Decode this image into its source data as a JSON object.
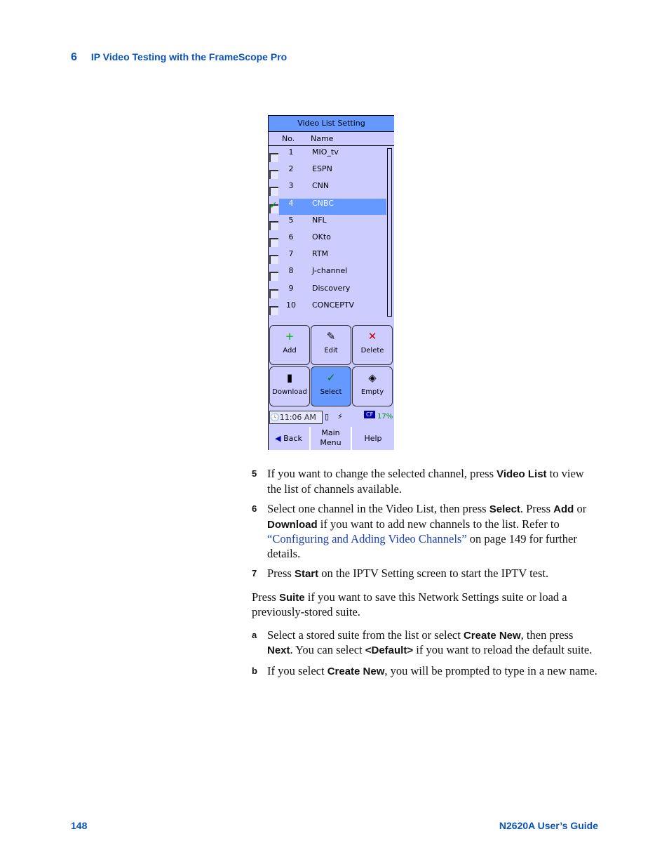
{
  "header": {
    "chapter": "6",
    "title": "IP Video Testing with the FrameScope Pro"
  },
  "device": {
    "title": "Video List Setting",
    "columns": [
      "No.",
      "Name"
    ],
    "rows": [
      {
        "no": "1",
        "name": "MIO_tv",
        "checked": false
      },
      {
        "no": "2",
        "name": "ESPN",
        "checked": false
      },
      {
        "no": "3",
        "name": "CNN",
        "checked": false
      },
      {
        "no": "4",
        "name": "CNBC",
        "checked": true
      },
      {
        "no": "5",
        "name": "NFL",
        "checked": false
      },
      {
        "no": "6",
        "name": "OKto",
        "checked": false
      },
      {
        "no": "7",
        "name": "RTM",
        "checked": false
      },
      {
        "no": "8",
        "name": "J-channel",
        "checked": false
      },
      {
        "no": "9",
        "name": "Discovery",
        "checked": false
      },
      {
        "no": "10",
        "name": "CONCEPTV",
        "checked": false
      }
    ],
    "buttons": {
      "add": "Add",
      "edit": "Edit",
      "delete": "Delete",
      "download": "Download",
      "select": "Select",
      "empty": "Empty"
    },
    "status": {
      "time": "11:06 AM",
      "storage": "17%",
      "cf": "CF"
    },
    "nav": {
      "back": "Back",
      "main_menu": "Main Menu",
      "help": "Help"
    }
  },
  "body": {
    "s5": {
      "n": "5",
      "t1": "If you want to change the selected channel, press ",
      "b1": "Video List",
      "t2": " to view the list of channels available."
    },
    "s6": {
      "n": "6",
      "t1": "Select one channel in the Video List, then press ",
      "b1": "Select",
      "t2": ". Press ",
      "b2": "Add",
      "t3": " or ",
      "b3": "Download",
      "t4": " if you want to add new channels to the list. Refer to ",
      "link": "“Configuring and Adding Video Channels”",
      "t5": " on page 149 for further details."
    },
    "s7": {
      "n": "7",
      "t1": "Press ",
      "b1": "Start",
      "t2": " on the IPTV Setting screen to start the IPTV test."
    },
    "para": {
      "t1": "Press ",
      "b1": "Suite",
      "t2": " if you want to save this Network Settings suite or load a previously-stored suite."
    },
    "sa": {
      "n": "a",
      "t1": "Select a stored suite from the list or select ",
      "b1": "Create New",
      "t2": ", then press ",
      "b2": "Next",
      "t3": ". You can select ",
      "b3": "<Default>",
      "t4": " if you want to reload the default suite."
    },
    "sb": {
      "n": "b",
      "t1": "If you select ",
      "b1": "Create New",
      "t2": ", you will be prompted to type in a new name."
    }
  },
  "footer": {
    "page": "148",
    "guide": "N2620A User’s Guide"
  }
}
